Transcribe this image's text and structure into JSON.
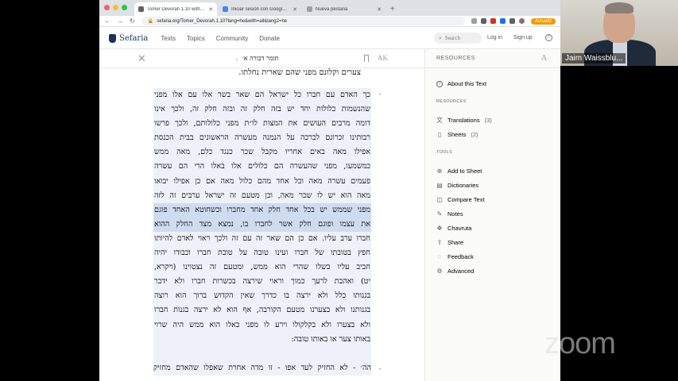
{
  "browser": {
    "tabs": [
      {
        "label": "Tomer Devorah 1.10 with Conn"
      },
      {
        "label": "Iniciar sesión con Google - Zoo"
      },
      {
        "label": "Nueva pestaña"
      }
    ],
    "new_tab": "+",
    "url": "sefaria.org/Tomer_Devorah.1.10?lang=he&with=all&lang2=he",
    "update_label": "Actualiz"
  },
  "sefaria": {
    "logo": "Sefaria",
    "nav": [
      "Texts",
      "Topics",
      "Community",
      "Donate"
    ],
    "search_placeholder": "Search",
    "login": "Log in",
    "signup": "Sign up"
  },
  "reader": {
    "title": "תומר דבורה א׳",
    "prev_line": "צערים וקלונם מפני שהם שארית נחלתו.",
    "segment_lines": [
      "כך האדם עם חברו כל ישראל הם שאר בשר אלו עם אלו מפני",
      "שהנשמות כלולות יחד יש בזה חלק זה ובזה חלק זה, ולכך אינו",
      "דומה מרבים העושים את המצות לו״ת מפני כלולותם, ולכך פרשו",
      "רבותינו זכרונם לברכה על הנמנה מעשרה הראשונים בבית הכנסת",
      "אפילו מאה באים אחריו מקבל שכר כנגד כלם, מאה ממש",
      "כמשמעו, מפני שהעשרה הם כלולים אלו באלו הרי הם עשרה",
      "פעמים עשרה מאה וכל אחד מהם כלול מאה אם כן אפילו יבואו",
      "מאה הוא יש לו שכר מאה, וכן מטעם זה ישראל ערבים זה לזה",
      "מפני שממש יש בכל אחד חלק אחד מחברו וכשחוטא האחד פוגם",
      "את עצמו ופוגם חלק אשר לחברו בו, נמצא מצד החלק ההוא",
      "חברו ערב עליו. אם כן הם שאר זה עם זה ולכך ראוי לאדם להיותו",
      "חפץ בטובתו של חברו ועינו טובה על טובת חברו וכבודו יהיה",
      "חביב עליו כשלו שהרי הוא ממש, ומטעם זה נצטוינו (ויקרא,",
      "יט) ואהבת לרעך כמוך וראוי שירצה בכשרות חברו ולא ידבר",
      "בגנותו כלל ולא ירצה בו כדרך שאין הקדוש ברוך הוא רוצה",
      "בגנותנו ולא בצערנו מטעם הקורבה, אף הוא לא ירצה בגנות חברו",
      "ולא בצערו ולא בקלקולו וירע לו מפני כאלו הוא ממש היה שרוי",
      "באותו צער או באותו טובה:"
    ],
    "next_line": "הה׳ - לא החזיק לעד אפו - זו מדה אחרת שאפלו שהאדם מחזיק"
  },
  "resources": {
    "header": "RESOURCES",
    "about": "About this Text",
    "section_resources": "RESOURCES",
    "translations_label": "Translations",
    "translations_count": "(3)",
    "sheets_label": "Sheets",
    "sheets_count": "(2)",
    "section_tools": "TOOLS",
    "tools": [
      "Add to Sheet",
      "Dictionaries",
      "Compare Text",
      "Notes",
      "Chavruta",
      "Share",
      "Feedback",
      "Advanced"
    ]
  },
  "zoom": {
    "watermark": "zoom",
    "participant_name": "Jaim Waissblu..."
  },
  "colors": {
    "sefaria_blue": "#18345d",
    "highlight": "#cfdcf0",
    "segment_bg": "#eef2f8"
  }
}
